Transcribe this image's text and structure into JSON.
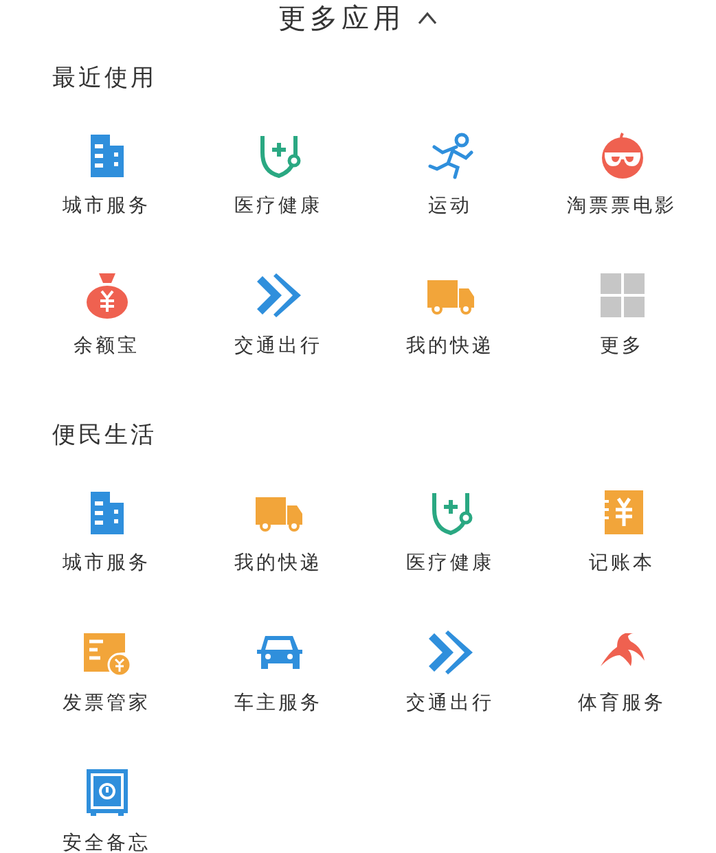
{
  "header": {
    "title": "更多应用"
  },
  "sections": [
    {
      "title": "最近使用",
      "apps": [
        {
          "label": "城市服务",
          "kind": "building"
        },
        {
          "label": "医疗健康",
          "kind": "stethoscope"
        },
        {
          "label": "运动",
          "kind": "runner"
        },
        {
          "label": "淘票票电影",
          "kind": "glasses"
        },
        {
          "label": "余额宝",
          "kind": "moneybag"
        },
        {
          "label": "交通出行",
          "kind": "chevrons"
        },
        {
          "label": "我的快递",
          "kind": "truck"
        },
        {
          "label": "更多",
          "kind": "grid"
        }
      ]
    },
    {
      "title": "便民生活",
      "apps": [
        {
          "label": "城市服务",
          "kind": "building"
        },
        {
          "label": "我的快递",
          "kind": "truck"
        },
        {
          "label": "医疗健康",
          "kind": "stethoscope"
        },
        {
          "label": "记账本",
          "kind": "ledger"
        },
        {
          "label": "发票管家",
          "kind": "invoice"
        },
        {
          "label": "车主服务",
          "kind": "car"
        },
        {
          "label": "交通出行",
          "kind": "chevrons"
        },
        {
          "label": "体育服务",
          "kind": "swallow"
        },
        {
          "label": "安全备忘",
          "kind": "safe"
        }
      ]
    }
  ]
}
